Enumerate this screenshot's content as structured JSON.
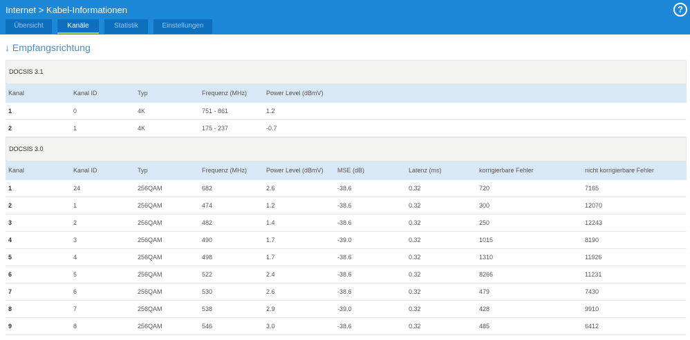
{
  "header": {
    "breadcrumb": "Internet > Kabel-Informationen",
    "help": "?"
  },
  "tabs": [
    {
      "label": "Übersicht",
      "w": 67
    },
    {
      "label": "Kanäle",
      "w": 60
    },
    {
      "label": "Statistik",
      "w": 63
    },
    {
      "label": "Einstellungen",
      "w": 85
    }
  ],
  "active_tab": "Kanäle",
  "section_title": "↓ Empfangsrichtung",
  "docsis31": {
    "label": "DOCSIS 3.1",
    "columns": [
      "Kanal",
      "Kanal ID",
      "Typ",
      "Frequenz (MHz)",
      "Power Level (dBmV)"
    ],
    "rows": [
      [
        "1",
        "0",
        "4K",
        "751 - 861",
        "1.2"
      ],
      [
        "2",
        "1",
        "4K",
        "175 - 237",
        "-0.7"
      ]
    ]
  },
  "docsis30": {
    "label": "DOCSIS 3.0",
    "columns": [
      "Kanal",
      "Kanal ID",
      "Typ",
      "Frequenz (MHz)",
      "Power Level (dBmV)",
      "MSE (dB)",
      "Latenz (ms)",
      "korrigierbare Fehler",
      "nicht korrigierbare Fehler"
    ],
    "rows": [
      [
        "1",
        "24",
        "256QAM",
        "682",
        "2.6",
        "-38.6",
        "0.32",
        "720",
        "7165"
      ],
      [
        "2",
        "1",
        "256QAM",
        "474",
        "1.2",
        "-38.6",
        "0.32",
        "300",
        "12070"
      ],
      [
        "3",
        "2",
        "256QAM",
        "482",
        "1.4",
        "-38.6",
        "0.32",
        "250",
        "12243"
      ],
      [
        "4",
        "3",
        "256QAM",
        "490",
        "1.7",
        "-39.0",
        "0.32",
        "1015",
        "8190"
      ],
      [
        "5",
        "4",
        "256QAM",
        "498",
        "1.7",
        "-38.6",
        "0.32",
        "1310",
        "11926"
      ],
      [
        "6",
        "5",
        "256QAM",
        "522",
        "2.4",
        "-38.6",
        "0.32",
        "8266",
        "11231"
      ],
      [
        "7",
        "6",
        "256QAM",
        "530",
        "2.6",
        "-38.6",
        "0.32",
        "479",
        "7430"
      ],
      [
        "8",
        "7",
        "256QAM",
        "538",
        "2.9",
        "-39.0",
        "0.32",
        "428",
        "9910"
      ],
      [
        "9",
        "8",
        "256QAM",
        "546",
        "3.0",
        "-38.6",
        "0.32",
        "485",
        "6412"
      ]
    ]
  }
}
